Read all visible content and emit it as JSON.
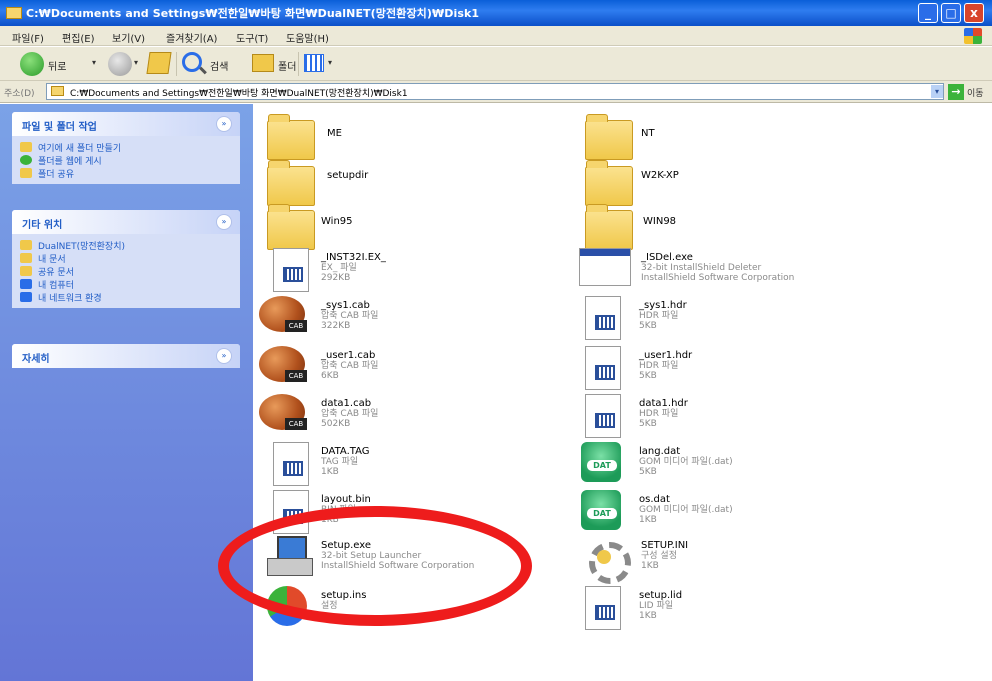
{
  "window": {
    "title": "C:₩Documents and Settings₩전한일₩바탕 화면₩DualNET(망전환장치)₩Disk1",
    "min_glyph": "_",
    "max_glyph": "□",
    "close_glyph": "x"
  },
  "menu": [
    {
      "label": "파일(F)",
      "icon": "menu-file"
    },
    {
      "label": "편집(E)",
      "icon": "menu-edit"
    },
    {
      "label": "보기(V)",
      "icon": "menu-view"
    },
    {
      "label": "즐겨찾기(A)",
      "icon": "menu-favorites"
    },
    {
      "label": "도구(T)",
      "icon": "menu-tools"
    },
    {
      "label": "도움말(H)",
      "icon": "menu-help"
    }
  ],
  "toolbar": {
    "back_label": "뒤로",
    "search_label": "검색",
    "folders_label": "폴더",
    "dropdown_glyph": "▾"
  },
  "address": {
    "label": "주소(D)",
    "path": "C:₩Documents and Settings₩전한일₩바탕 화면₩DualNET(망전환장치)₩Disk1",
    "go_glyph": "→",
    "go_label": "이동",
    "drop_glyph": "▾"
  },
  "left_panels": {
    "file_tasks": {
      "title": "파일 및 폴더 작업",
      "toggle_glyph": "»",
      "items": [
        {
          "label": "여기에 새 폴더 만들기",
          "color": "#f0c84a"
        },
        {
          "label": "폴더를 웹에 게시",
          "color": "#3bb33b"
        },
        {
          "label": "폴더 공유",
          "color": "#f0c84a"
        }
      ]
    },
    "other_places": {
      "title": "기타 위치",
      "toggle_glyph": "»",
      "items": [
        {
          "label": "DualNET(망전환장치)",
          "color": "#f0c84a"
        },
        {
          "label": "내 문서",
          "color": "#f0c84a"
        },
        {
          "label": "공유 문서",
          "color": "#f0c84a"
        },
        {
          "label": "내 컴퓨터",
          "color": "#2a6de8"
        },
        {
          "label": "내 네트워크 환경",
          "color": "#2a6de8"
        }
      ]
    },
    "details": {
      "title": "자세히",
      "toggle_glyph": "»"
    }
  },
  "files": [
    {
      "name": "ME",
      "type": "folder",
      "line1": "",
      "line2": "",
      "line3": ""
    },
    {
      "name": "NT",
      "type": "folder",
      "line1": "",
      "line2": "",
      "line3": ""
    },
    {
      "name": "setupdir",
      "type": "folder",
      "line1": "",
      "line2": "",
      "line3": ""
    },
    {
      "name": "W2K-XP",
      "type": "folder",
      "line1": "",
      "line2": "",
      "line3": ""
    },
    {
      "name": "Win95",
      "type": "folder",
      "line1": "",
      "line2": "",
      "line3": ""
    },
    {
      "name": "WIN98",
      "type": "folder",
      "line1": "",
      "line2": "",
      "line3": ""
    },
    {
      "name": "_INST32I.EX_",
      "type": "doc",
      "line1": "EX_ 파일",
      "line2": "292KB",
      "line3": ""
    },
    {
      "name": "_ISDel.exe",
      "type": "app",
      "line1": "32-bit InstallShield Deleter",
      "line2": "InstallShield Software Corporation",
      "line3": ""
    },
    {
      "name": "_sys1.cab",
      "type": "cab",
      "line1": "압축 CAB 파일",
      "line2": "322KB",
      "line3": ""
    },
    {
      "name": "_sys1.hdr",
      "type": "doc",
      "line1": "HDR 파일",
      "line2": "5KB",
      "line3": ""
    },
    {
      "name": "_user1.cab",
      "type": "cab",
      "line1": "압축 CAB 파일",
      "line2": "6KB",
      "line3": ""
    },
    {
      "name": "_user1.hdr",
      "type": "doc",
      "line1": "HDR 파일",
      "line2": "5KB",
      "line3": ""
    },
    {
      "name": "data1.cab",
      "type": "cab",
      "line1": "압축 CAB 파일",
      "line2": "502KB",
      "line3": ""
    },
    {
      "name": "data1.hdr",
      "type": "doc",
      "line1": "HDR 파일",
      "line2": "5KB",
      "line3": ""
    },
    {
      "name": "DATA.TAG",
      "type": "doc",
      "line1": "TAG 파일",
      "line2": "1KB",
      "line3": ""
    },
    {
      "name": "lang.dat",
      "type": "dat",
      "line1": "GOM 미디어 파일(.dat)",
      "line2": "5KB",
      "line3": ""
    },
    {
      "name": "layout.bin",
      "type": "doc",
      "line1": "BIN 파일",
      "line2": "1KB",
      "line3": ""
    },
    {
      "name": "os.dat",
      "type": "dat",
      "line1": "GOM 미디어 파일(.dat)",
      "line2": "1KB",
      "line3": ""
    },
    {
      "name": "Setup.exe",
      "type": "setup",
      "line1": "32-bit Setup Launcher",
      "line2": "InstallShield Software Corporation",
      "line3": ""
    },
    {
      "name": "SETUP.INI",
      "type": "gear",
      "line1": "구성 설정",
      "line2": "1KB",
      "line3": ""
    },
    {
      "name": "setup.ins",
      "type": "ins",
      "line1": "설정",
      "line2": "",
      "line3": ""
    },
    {
      "name": "setup.lid",
      "type": "doc",
      "line1": "LID 파일",
      "line2": "1KB",
      "line3": ""
    }
  ],
  "icon_tags": {
    "cab": "CAB",
    "dat": "DAT"
  },
  "colors": {
    "title_bar": "#0a5fd8",
    "left_pane": "#7ba2e7",
    "highlight": "#ee1c1c"
  }
}
